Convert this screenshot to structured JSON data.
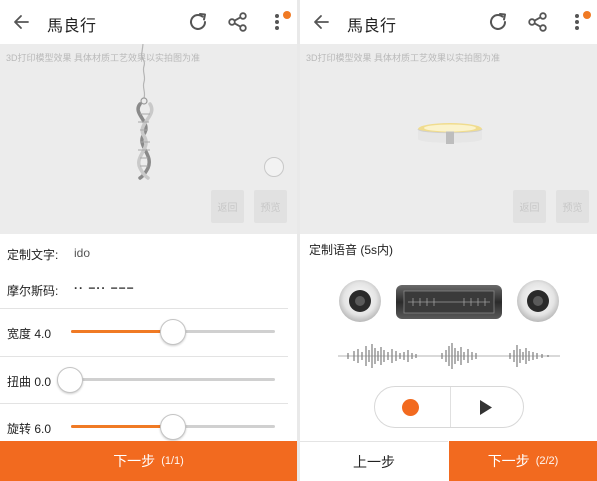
{
  "left": {
    "header": {
      "title": "馬良行"
    },
    "viewer": {
      "disclaimer": "3D打印模型效果 具体材质工艺效果以实拍图为准",
      "back_label": "返回",
      "preview_label": "预览"
    },
    "form": {
      "custom_text_label": "定制文字:",
      "custom_text_value": "ido",
      "morse_label": "摩尔斯码:",
      "morse_value": "·· −·· −−−",
      "sliders": [
        {
          "label": "宽度 4.0",
          "fraction": 0.5
        },
        {
          "label": "扭曲 0.0",
          "fraction": 0.0
        },
        {
          "label": "旋转 6.0",
          "fraction": 0.5
        }
      ]
    },
    "footer": {
      "next_label": "下一步",
      "next_step": "(1/1)"
    }
  },
  "right": {
    "header": {
      "title": "馬良行"
    },
    "viewer": {
      "disclaimer": "3D打印模型效果 具体材质工艺效果以实拍图为准",
      "back_label": "返回",
      "preview_label": "预览"
    },
    "voice": {
      "label": "定制语音 (5s内)"
    },
    "footer": {
      "prev_label": "上一步",
      "next_label": "下一步",
      "next_step": "(2/2)"
    }
  },
  "colors": {
    "accent": "#f26a1f",
    "badge": "#f07a24"
  }
}
